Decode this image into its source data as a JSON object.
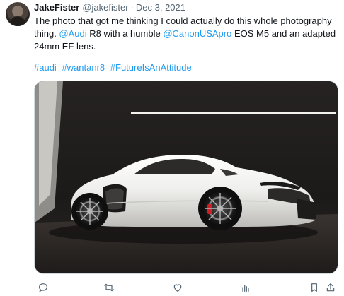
{
  "tweet": {
    "author_name": "JakeFister",
    "author_handle": "@jakefister",
    "separator": "·",
    "date": "Dec 3, 2021",
    "line1": "The photo that got me thinking I could actually do this whole photography",
    "line2_prefix": "thing. ",
    "mention_audi": "@Audi",
    "line2_mid": " R8 with a humble ",
    "mention_canon": "@CanonUSApro",
    "line2_suffix": " EOS M5 and an adapted",
    "line3": "24mm EF lens.",
    "hashtags": [
      "#audi",
      "#wantanr8",
      "#FutureIsAnAttitude"
    ]
  },
  "actions": {
    "reply_icon": "reply-icon",
    "retweet_icon": "retweet-icon",
    "like_icon": "heart-icon",
    "views_icon": "views-icon",
    "bookmark_icon": "bookmark-icon",
    "share_icon": "share-icon"
  },
  "colors": {
    "link": "#1d9bf0",
    "text": "#0f1419",
    "muted": "#536471",
    "car": "#f1f1ef",
    "studio": "#1c1a19"
  }
}
